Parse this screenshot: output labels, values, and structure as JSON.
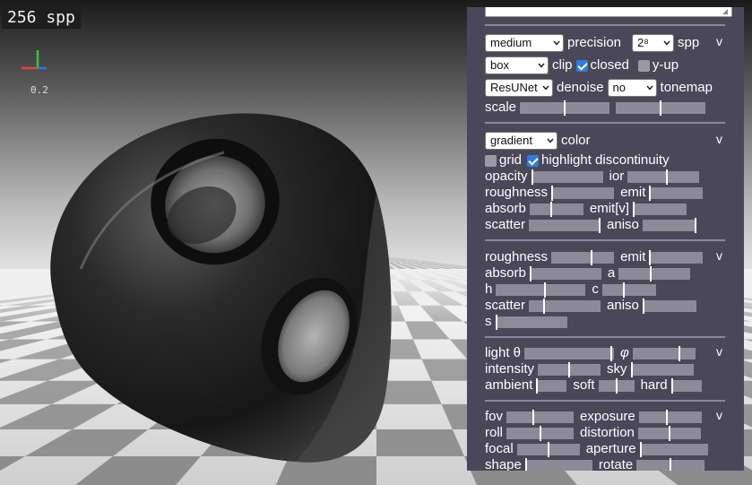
{
  "viewport": {
    "spp_readout": "256 spp",
    "axis_value": "0.2",
    "axis_colors": {
      "x": "#e0453a",
      "y": "#3ac43a",
      "z": "#3a6ee0"
    }
  },
  "panel": {
    "colors": {
      "background": "#4a4858",
      "slider_track": "#8c8a97",
      "checkbox_on": "#2f7be0"
    },
    "collapse_label": "v",
    "render": {
      "precision_select": "medium",
      "precision_label": "precision",
      "spp_select": "2⁸",
      "spp_label": "spp",
      "clip_select": "box",
      "clip_label": "clip",
      "closed_label": "closed",
      "closed_checked": true,
      "yup_label": "y-up",
      "yup_checked": false,
      "denoise_select": "ResUNet",
      "denoise_label": "denoise",
      "tonemap_select": "no",
      "tonemap_label": "tonemap",
      "scale_label": "scale",
      "scale_values": [
        0.5,
        0.5
      ]
    },
    "material": {
      "color_select": "gradient",
      "color_label": "color",
      "grid_label": "grid",
      "grid_checked": false,
      "highlight_label": "highlight discontinuity",
      "highlight_checked": true,
      "opacity_label": "opacity",
      "opacity_value": 0.0,
      "ior_label": "ior",
      "ior_value": 0.55,
      "roughness_label": "roughness",
      "roughness_value": 0.0,
      "emit_label": "emit",
      "emit_value": 0.0,
      "absorb_label": "absorb",
      "absorb_value": 0.4,
      "emitv_label": "emit[v]",
      "emitv_value": 0.0,
      "scatter_label": "scatter",
      "scatter_value": 1.0,
      "aniso_label": "aniso",
      "aniso_value": 1.0
    },
    "background": {
      "roughness_label": "roughness",
      "roughness_value": 0.65,
      "emit_label": "emit",
      "emit_value": 0.0,
      "absorb_label": "absorb",
      "absorb_value": 0.0,
      "a_label": "a",
      "a_value": 0.45,
      "h_label": "h",
      "h_value": 0.55,
      "c_label": "c",
      "c_value": 0.4,
      "scatter_label": "scatter",
      "scatter_value": 0.2,
      "aniso_label": "aniso",
      "aniso_value": 0.0,
      "s_label": "s",
      "s_value": 0.0
    },
    "light": {
      "theta_label": "light θ",
      "theta_value": 0.98,
      "phi_label": "φ",
      "phi_value": 0.75,
      "intensity_label": "intensity",
      "intensity_value": 0.5,
      "sky_label": "sky",
      "sky_value": 0.0,
      "ambient_label": "ambient",
      "ambient_value": 0.0,
      "soft_label": "soft",
      "soft_value": 0.5,
      "hard_label": "hard",
      "hard_value": 0.0
    },
    "camera": {
      "fov_label": "fov",
      "fov_value": 0.4,
      "exposure_label": "exposure",
      "exposure_value": 0.45,
      "roll_label": "roll",
      "roll_value": 0.5,
      "distortion_label": "distortion",
      "distortion_value": 0.5,
      "focal_label": "focal",
      "focal_value": 0.5,
      "aperture_label": "aperture",
      "aperture_value": 0.0,
      "shape_label": "shape",
      "shape_value": 0.0,
      "rotate_label": "rotate",
      "rotate_value": 0.5
    }
  }
}
